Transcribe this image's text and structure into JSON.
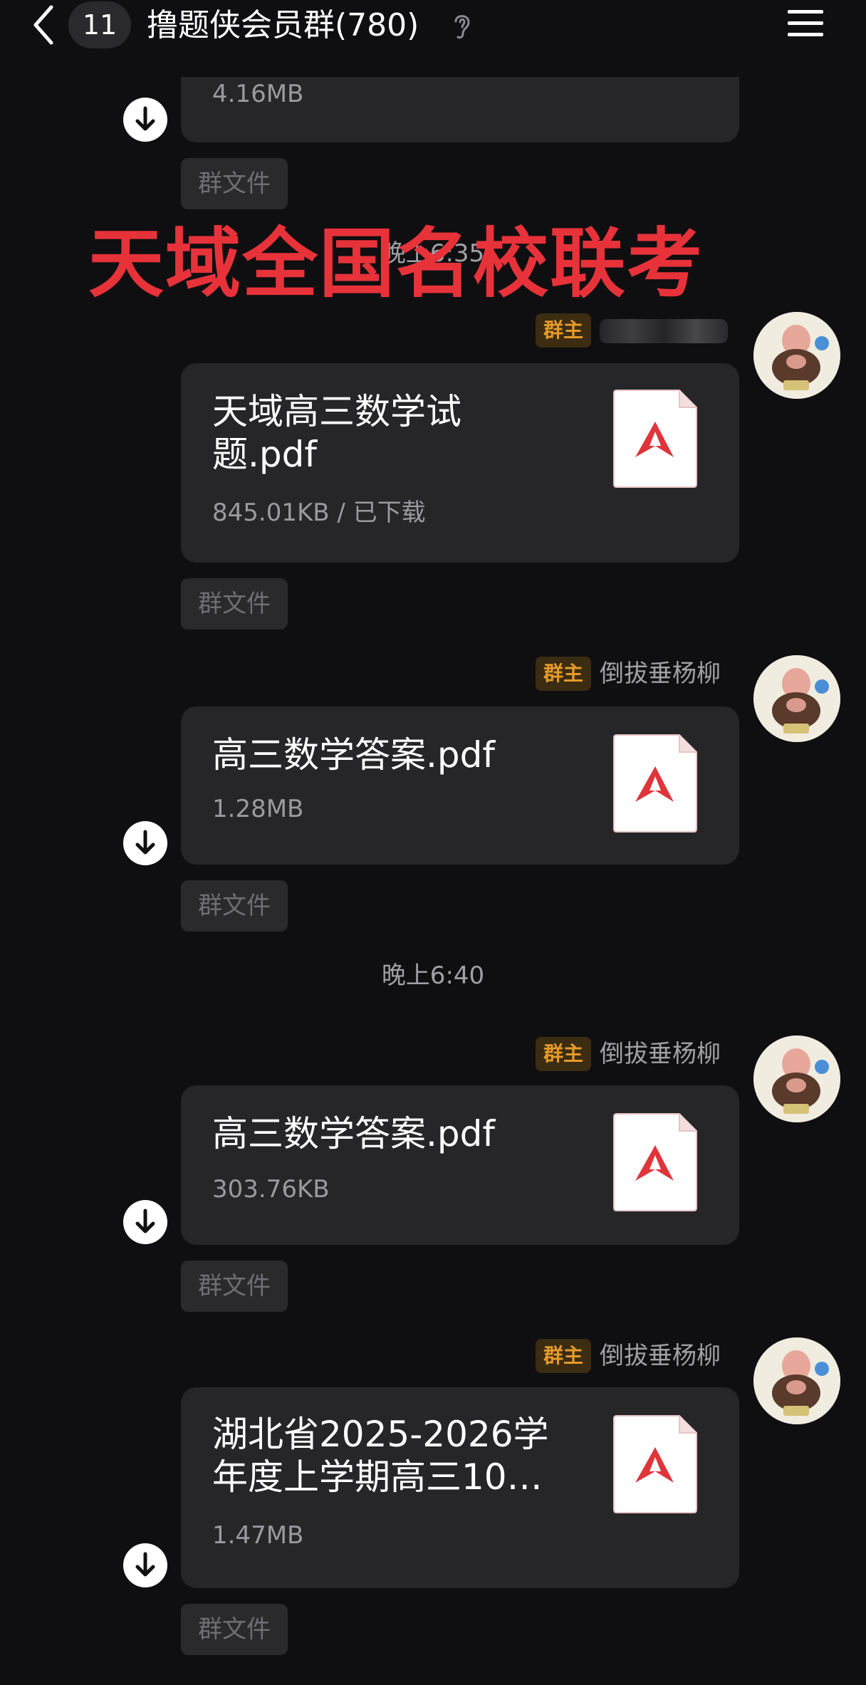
{
  "header": {
    "unread_count": "11",
    "title": "撸题侠会员群(780)"
  },
  "overlay_text": "天域全国名校联考",
  "messages": [
    {
      "file_size": "4.16MB",
      "tag": "群文件"
    },
    {
      "time_partial": "晚上6:35",
      "role": "群主",
      "file_name_lines": [
        "天域高三数学试",
        "题.pdf"
      ],
      "file_size": "845.01KB / 已下载",
      "tag": "群文件"
    },
    {
      "role": "群主",
      "sender": "倒拔垂杨柳",
      "file_name": "高三数学答案.pdf",
      "file_size": "1.28MB",
      "tag": "群文件"
    },
    {
      "time": "晚上6:40"
    },
    {
      "role": "群主",
      "sender": "倒拔垂杨柳",
      "file_name": "高三数学答案.pdf",
      "file_size": "303.76KB",
      "tag": "群文件"
    },
    {
      "role": "群主",
      "sender": "倒拔垂杨柳",
      "file_name_lines": [
        "湖北省2025-2026学",
        "年度上学期高三10…"
      ],
      "file_size": "1.47MB",
      "tag": "群文件"
    }
  ],
  "colors": {
    "background": "#0f0f11",
    "bubble": "#262628",
    "overlay_red": "#e8323a",
    "owner_badge": "#e49a2a",
    "pdf_red": "#e0343b"
  },
  "icons": [
    "back-arrow-icon",
    "ear-icon",
    "menu-icon",
    "download-icon",
    "pdf-icon",
    "avatar"
  ]
}
